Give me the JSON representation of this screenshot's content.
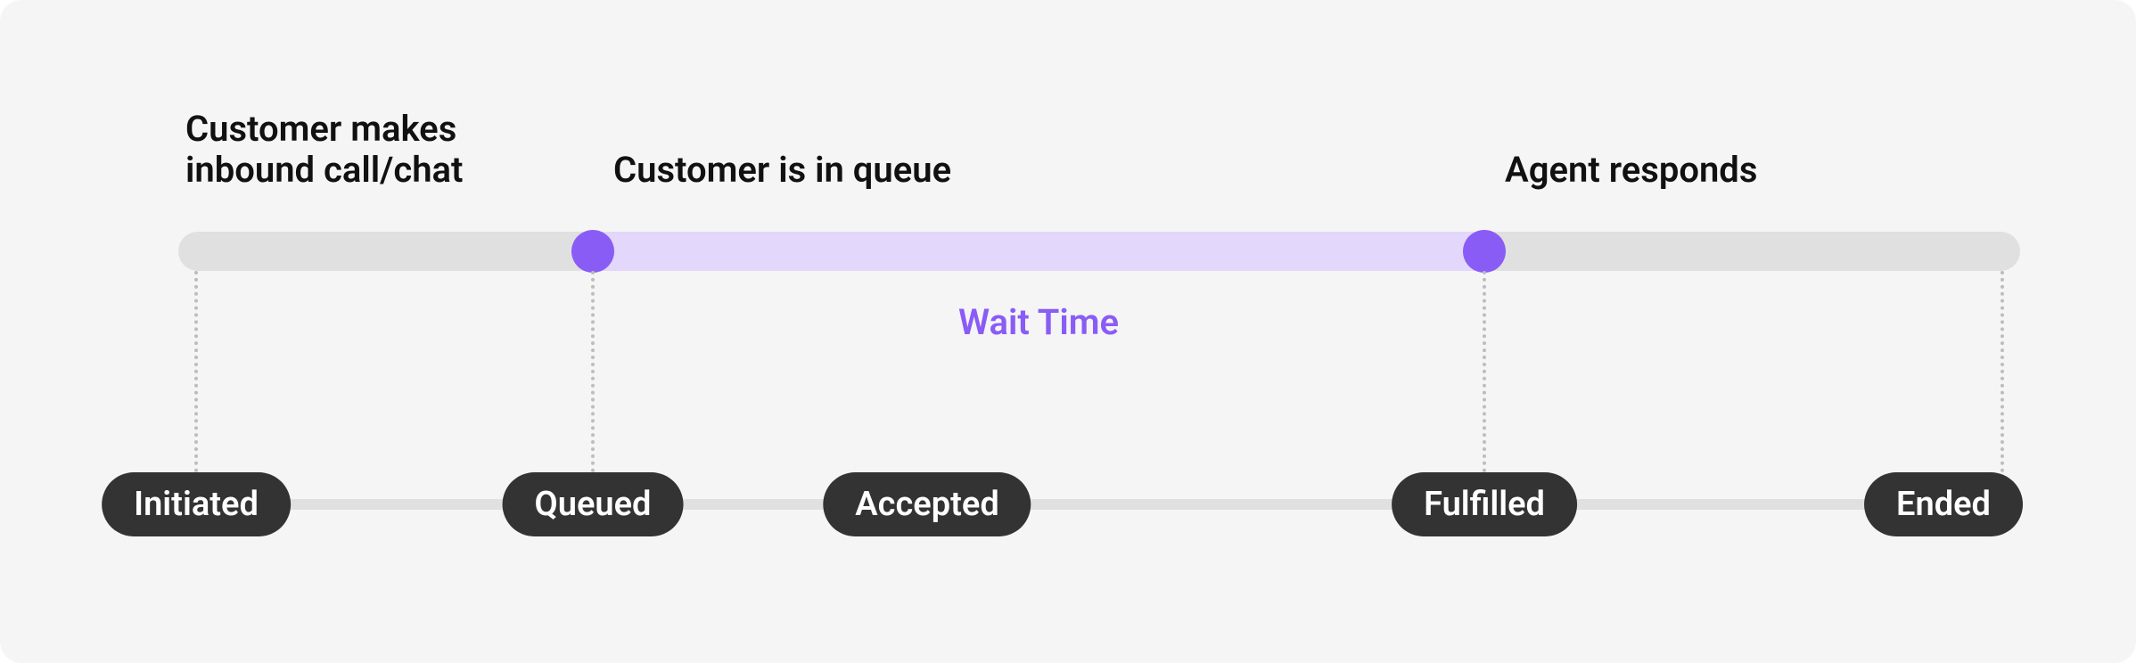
{
  "upper_labels": {
    "initiated": "Customer makes\ninbound call/chat",
    "queued": "Customer is in queue",
    "fulfilled": "Agent responds"
  },
  "wait_time_label": "Wait Time",
  "statuses": {
    "initiated": "Initiated",
    "queued": "Queued",
    "accepted": "Accepted",
    "fulfilled": "Fulfilled",
    "ended": "Ended"
  },
  "colors": {
    "track": "#e0e0e0",
    "highlight": "#e3d7fb",
    "accent": "#8a5cf6",
    "pill": "#333333"
  }
}
